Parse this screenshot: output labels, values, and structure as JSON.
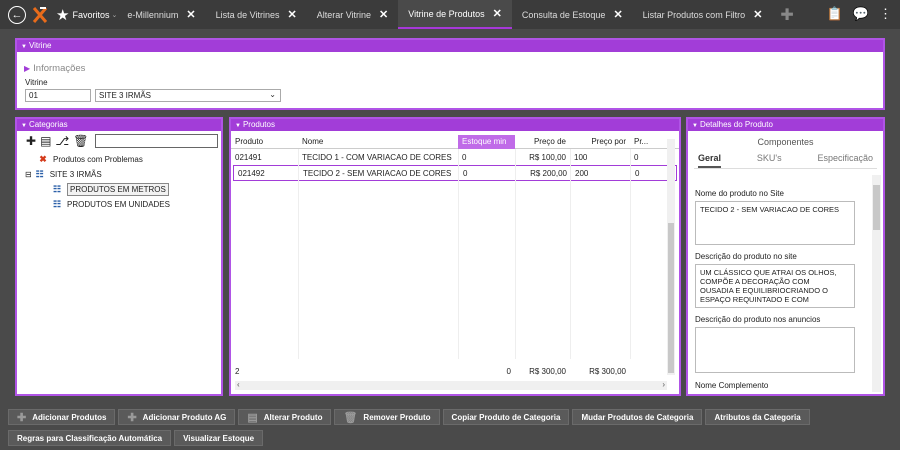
{
  "topbar": {
    "favorites_label": "Favoritos",
    "tabs": [
      {
        "label": "e-Millennium",
        "active": false
      },
      {
        "label": "Lista de Vitrines",
        "active": false
      },
      {
        "label": "Alterar Vitrine",
        "active": false
      },
      {
        "label": "Vitrine de Produtos",
        "active": true
      },
      {
        "label": "Consulta de Estoque",
        "active": false
      },
      {
        "label": "Listar Produtos com Filtro",
        "active": false
      }
    ],
    "accent_color": "#a23dd8"
  },
  "vitrine_panel": {
    "title": "Vitrine",
    "section": "Informações",
    "field_label": "Vitrine",
    "code_value": "01",
    "select_value": "SITE 3 IRMÃS"
  },
  "categorias": {
    "title": "Categorias",
    "search_value": "",
    "tree": [
      {
        "label": "Produtos com Problemas",
        "icon": "red-x-icon"
      },
      {
        "label": "SITE 3 IRMÃS",
        "icon": "tree-icon"
      },
      {
        "label": "PRODUTOS EM METROS",
        "icon": "tree-icon"
      },
      {
        "label": "PRODUTOS EM UNIDADES",
        "icon": "tree-icon"
      }
    ]
  },
  "produtos": {
    "title": "Produtos",
    "columns": [
      "Produto",
      "Nome",
      "Estoque min",
      "Preço de",
      "Preço por",
      "Pr..."
    ],
    "rows": [
      {
        "produto": "021491",
        "nome": "TECIDO 1  - COM VARIACAO DE CORES",
        "estoque": "0",
        "preco_de": "R$ 100,00",
        "preco_por": "100",
        "pr": "0"
      },
      {
        "produto": "021492",
        "nome": "TECIDO 2  - SEM VARIACAO DE CORES",
        "estoque": "0",
        "preco_de": "R$ 200,00",
        "preco_por": "200",
        "pr": "0"
      }
    ],
    "footer": {
      "count": "2",
      "estoque": "0",
      "preco_de": "R$ 300,00",
      "preco_por": "R$ 300,00"
    }
  },
  "detalhes": {
    "title": "Detalhes do Produto",
    "components_label": "Componentes",
    "tabs": [
      "Geral",
      "SKU's",
      "Especificação"
    ],
    "nome_site_label": "Nome do produto no Site",
    "nome_site_value": "TECIDO 2  - SEM VARIACAO DE CORES",
    "descricao_site_label": "Descrição do produto no site",
    "descricao_site_value": "UM CLÁSSICO QUE ATRAI OS OLHOS, COMPÕE A DECORAÇÃO COM OUSADIA E EQUILIBRIOCRIANDO O ESPAÇO REQUINTADO E COM",
    "descricao_anuncios_label": "Descrição do produto nos anuncios",
    "nome_complemento_label": "Nome Complemento"
  },
  "buttons_row1": [
    "Adicionar Produtos",
    "Adicionar Produto AG",
    "Alterar Produto",
    "Remover Produto",
    "Copiar Produto de Categoria",
    "Mudar Produtos de Categoria",
    "Atributos da Categoria"
  ],
  "buttons_row2": [
    "Regras para Classificação Automática",
    "Visualizar Estoque"
  ]
}
